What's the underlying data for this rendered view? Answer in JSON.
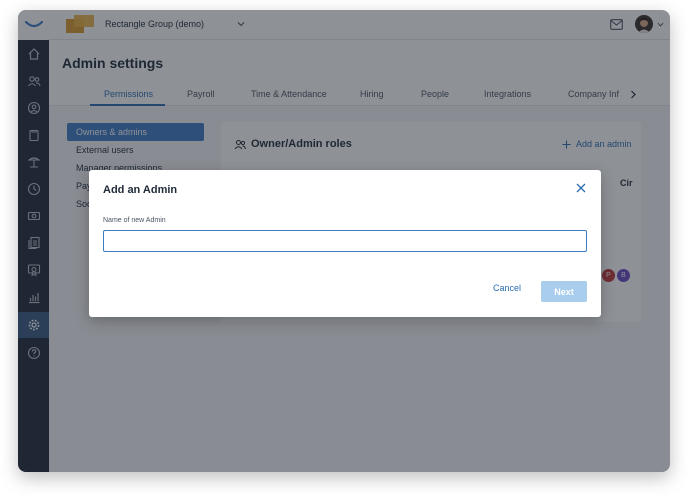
{
  "topbar": {
    "company_name": "Rectangle Group (demo)",
    "icons": [
      "company-logo-icon",
      "chevron-down-icon",
      "mail-icon",
      "avatar"
    ]
  },
  "sidebar": {
    "items": [
      {
        "icon": "home-icon"
      },
      {
        "icon": "people-icon"
      },
      {
        "icon": "user-search-icon"
      },
      {
        "icon": "clipboard-icon"
      },
      {
        "icon": "beach-icon"
      },
      {
        "icon": "clock-icon"
      },
      {
        "icon": "money-icon"
      },
      {
        "icon": "documents-icon"
      },
      {
        "icon": "certificate-icon"
      },
      {
        "icon": "reports-icon"
      },
      {
        "icon": "gear-icon",
        "active": true
      },
      {
        "icon": "help-icon"
      }
    ]
  },
  "header": {
    "title": "Admin settings",
    "tabs": [
      {
        "label": "Permissions",
        "active": true
      },
      {
        "label": "Payroll"
      },
      {
        "label": "Time & Attendance"
      },
      {
        "label": "Hiring"
      },
      {
        "label": "People"
      },
      {
        "label": "Integrations"
      },
      {
        "label": "Company Inf"
      }
    ]
  },
  "settings_nav": {
    "items": [
      {
        "label": "Owners & admins",
        "active": true
      },
      {
        "label": "External users"
      },
      {
        "label": "Manager permissions"
      },
      {
        "label": "Pay"
      },
      {
        "label": "Soc"
      }
    ]
  },
  "roles_card": {
    "title": "Owner/Admin roles",
    "add_admin_label": "Add an admin",
    "column_peek": "Cir",
    "badges": [
      "P",
      "B"
    ]
  },
  "modal": {
    "title": "Add an Admin",
    "field_label": "Name of new Admin",
    "field_value": "",
    "field_placeholder": "",
    "cancel_label": "Cancel",
    "next_label": "Next"
  },
  "colors": {
    "accent": "#2b6cb0",
    "sidebar": "#1f2a38",
    "next_disabled": "#a9cdec"
  }
}
